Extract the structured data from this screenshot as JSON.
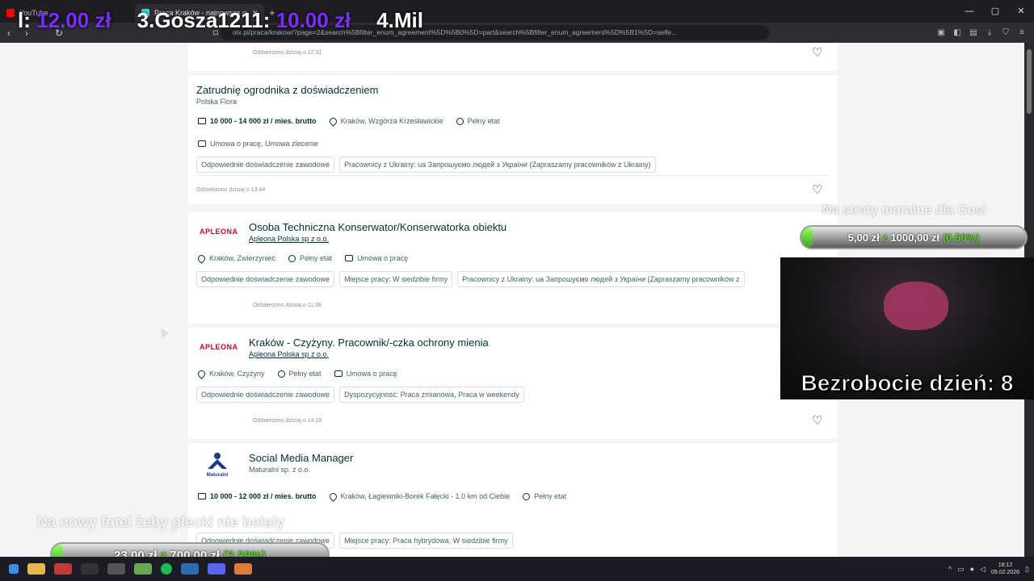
{
  "browser": {
    "tabs": [
      {
        "label": "YouTube",
        "favicon_color": "#ff0000"
      },
      {
        "label": "Praca Kraków - najnowsze ofert",
        "favicon_color": "#23e5db"
      }
    ],
    "url": "olx.pl/praca/krakow/?page=2&search%5Bfilter_enum_agreement%5D%5B0%5D=part&search%5Bfilter_enum_agreement%5D%5B1%5D=selfe..."
  },
  "overlay_top": {
    "items": [
      {
        "label": "l:",
        "amount": "12.00 zł"
      },
      {
        "label": "3.Gosza1211:",
        "amount": "10.00 zł"
      },
      {
        "label": "4.Mil",
        "amount": ""
      }
    ]
  },
  "goal_right": {
    "label": "Na straty moralne dla Gosi",
    "current": "5,00 zł",
    "sep": "z",
    "target": "1000,00 zł",
    "percent_text": "(0.50%)",
    "fraction": 0.005
  },
  "goal_left": {
    "label": "Na nowy fotel żeby plecki nie bolały",
    "current": "23,00 zł",
    "sep": "z",
    "target": "700,00 zł",
    "percent_text": "(3.29%)",
    "fraction": 0.0329
  },
  "webcam": {
    "caption": "Bezrobocie dzień: 8"
  },
  "listings": [
    {
      "refresh": "Odświeżono dzisiaj o 12:31"
    },
    {
      "title": "Zatrudnię ogrodnika z doświadczeniem",
      "company": "Polska Flora",
      "salary": "10 000 - 14 000 zł / mies. brutto",
      "location": "Kraków, Wzgórza Krzesławickie",
      "time": "Pełny etat",
      "contract": "Umowa o pracę, Umowa zlecenie",
      "tags": [
        "Odpowiednie doświadczenie zawodowe",
        "Pracownicy z Ukrainy: ua Запрошуємо людей з України (Zapraszamy pracowników z Ukrainy)"
      ],
      "refresh": "Odświeżono dzisiaj o 13:44"
    },
    {
      "logo": "APLEONA",
      "title": "Osoba Techniczna Konserwator/Konserwatorka obiektu",
      "company": "Apleona Polska sp z o.o.",
      "location": "Kraków, Zwierzyniec",
      "time": "Pełny etat",
      "contract": "Umowa o pracę",
      "tags": [
        "Odpowiednie doświadczenie zawodowe",
        "Miejsce pracy: W siedzibie firmy",
        "Pracownicy z Ukrainy: ua Запрошуємо людей з України (Zapraszamy pracowników z"
      ],
      "refresh": "Odświeżono dzisiaj o 11:38"
    },
    {
      "logo": "APLEONA",
      "title": "Kraków - Czyżyny. Pracownik/-czka ochrony mienia",
      "company": "Apleona Polska sp z o.o.",
      "location": "Kraków, Czyżyny",
      "time": "Pełny etat",
      "contract": "Umowa o pracę",
      "tags": [
        "Odpowiednie doświadczenie zawodowe",
        "Dyspozycyjność: Praca zmianowa, Praca w weekendy"
      ],
      "refresh": "Odświeżono dzisiaj o 14:18"
    },
    {
      "logo": "Maturalni",
      "title": "Social Media Manager",
      "company": "Maturalni sp. z o.o.",
      "salary": "10 000 - 12 000 zł / mies. brutto",
      "location": "Kraków, Łagiewniki-Borek Fałęcki - 1.0 km od Ciebie",
      "time": "Pełny etat",
      "tags": [
        "Odpowiednie doświadczenie zawodowe",
        "Miejsce pracy: Praca hybrydowa, W siedzibie firmy"
      ]
    }
  ],
  "taskbar": {
    "time": "18:12",
    "date": "09.02.2026"
  }
}
